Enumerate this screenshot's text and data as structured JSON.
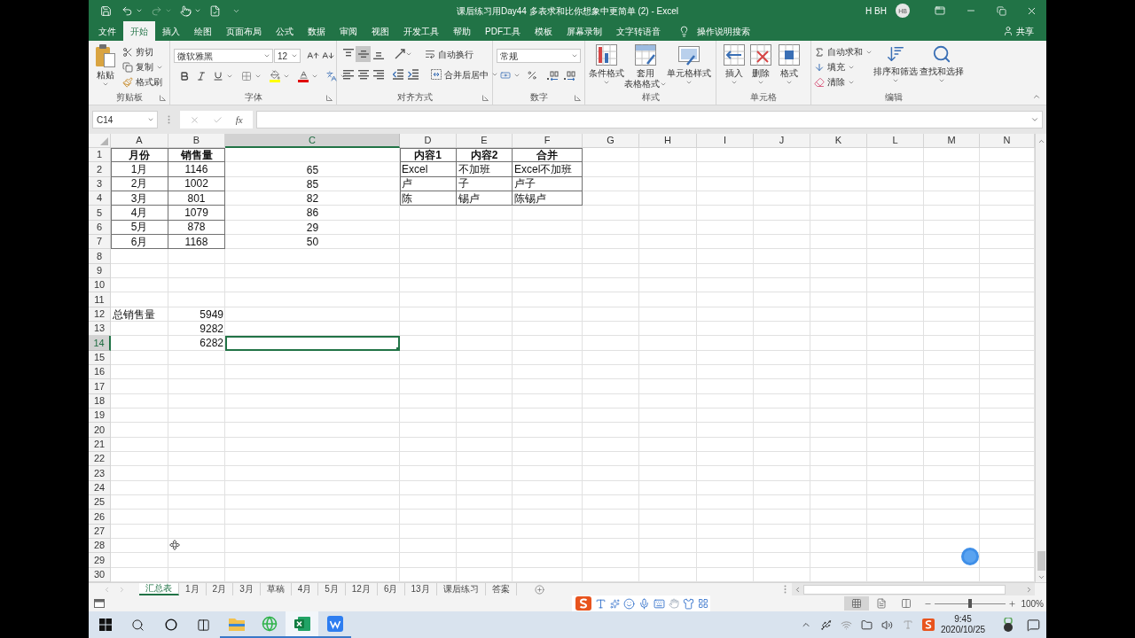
{
  "window": {
    "title": "课后练习用Day44 多表求和比你想象中更简单 (2) - Excel",
    "user": "H BH",
    "avatar": "HB"
  },
  "ribbon_tabs": [
    {
      "label": "文件",
      "selected": false
    },
    {
      "label": "开始",
      "selected": true
    },
    {
      "label": "插入",
      "selected": false
    },
    {
      "label": "绘图",
      "selected": false
    },
    {
      "label": "页面布局",
      "selected": false
    },
    {
      "label": "公式",
      "selected": false
    },
    {
      "label": "数据",
      "selected": false
    },
    {
      "label": "审阅",
      "selected": false
    },
    {
      "label": "视图",
      "selected": false
    },
    {
      "label": "开发工具",
      "selected": false
    },
    {
      "label": "帮助",
      "selected": false
    },
    {
      "label": "PDF工具",
      "selected": false
    },
    {
      "label": "模板",
      "selected": false
    },
    {
      "label": "屏幕录制",
      "selected": false
    },
    {
      "label": "文字转语音",
      "selected": false
    }
  ],
  "tell_me": "操作说明搜索",
  "share": "共享",
  "ribbon": {
    "clipboard": {
      "paste": "粘贴",
      "cut": "剪切",
      "copy": "复制",
      "format_painter": "格式刷",
      "label": "剪贴板"
    },
    "font": {
      "name": "微软雅黑",
      "size": "12",
      "label": "字体"
    },
    "alignment": {
      "vertical": [
        {
          "kind": "top",
          "selected": false
        },
        {
          "kind": "middle",
          "selected": true
        },
        {
          "kind": "bottom",
          "selected": false
        }
      ],
      "wrap_text": "自动换行",
      "merge_center": "合并后居中",
      "label": "对齐方式"
    },
    "number": {
      "format": "常规",
      "label": "数字"
    },
    "styles": {
      "conditional_formatting": "条件格式",
      "format_as_table": [
        "套用",
        "表格格式"
      ],
      "cell_styles": "单元格样式",
      "label": "样式"
    },
    "cells": {
      "insert": "插入",
      "delete": "删除",
      "format": "格式",
      "label": "单元格"
    },
    "editing": {
      "autosum": "自动求和",
      "fill": "填充",
      "clear": "清除",
      "sort_filter": "排序和筛选",
      "find_select": "查找和选择",
      "label": "编辑"
    }
  },
  "formula_bar": {
    "name_box": "C14",
    "function_button": "fx"
  },
  "sheet": {
    "columns": [
      {
        "label": "A",
        "selected": false
      },
      {
        "label": "B",
        "selected": false
      },
      {
        "label": "C",
        "selected": true
      },
      {
        "label": "D",
        "selected": false
      },
      {
        "label": "E",
        "selected": false
      },
      {
        "label": "F",
        "selected": false
      },
      {
        "label": "G",
        "selected": false
      },
      {
        "label": "H",
        "selected": false
      },
      {
        "label": "I",
        "selected": false
      },
      {
        "label": "J",
        "selected": false
      },
      {
        "label": "K",
        "selected": false
      },
      {
        "label": "L",
        "selected": false
      },
      {
        "label": "M",
        "selected": false
      },
      {
        "label": "N",
        "selected": false
      }
    ],
    "rows": [
      {
        "label": "1",
        "selected": false
      },
      {
        "label": "2",
        "selected": false
      },
      {
        "label": "3",
        "selected": false
      },
      {
        "label": "4",
        "selected": false
      },
      {
        "label": "5",
        "selected": false
      },
      {
        "label": "6",
        "selected": false
      },
      {
        "label": "7",
        "selected": false
      },
      {
        "label": "8",
        "selected": false
      },
      {
        "label": "9",
        "selected": false
      },
      {
        "label": "10",
        "selected": false
      },
      {
        "label": "11",
        "selected": false
      },
      {
        "label": "12",
        "selected": false
      },
      {
        "label": "13",
        "selected": false
      },
      {
        "label": "14",
        "selected": true
      },
      {
        "label": "15",
        "selected": false
      },
      {
        "label": "16",
        "selected": false
      },
      {
        "label": "17",
        "selected": false
      },
      {
        "label": "18",
        "selected": false
      },
      {
        "label": "19",
        "selected": false
      },
      {
        "label": "20",
        "selected": false
      },
      {
        "label": "21",
        "selected": false
      },
      {
        "label": "22",
        "selected": false
      },
      {
        "label": "23",
        "selected": false
      },
      {
        "label": "24",
        "selected": false
      },
      {
        "label": "25",
        "selected": false
      },
      {
        "label": "26",
        "selected": false
      },
      {
        "label": "27",
        "selected": false
      },
      {
        "label": "28",
        "selected": false
      },
      {
        "label": "29",
        "selected": false
      },
      {
        "label": "30",
        "selected": false
      }
    ],
    "sales_table": {
      "header": [
        "月份",
        "销售量"
      ],
      "rows": [
        [
          "1月",
          "1146"
        ],
        [
          "2月",
          "1002"
        ],
        [
          "3月",
          "801"
        ],
        [
          "4月",
          "1079"
        ],
        [
          "5月",
          "878"
        ],
        [
          "6月",
          "1168"
        ]
      ]
    },
    "column_c_values": [
      "65",
      "85",
      "82",
      "86",
      "29",
      "50"
    ],
    "content_table": {
      "header": [
        "内容1",
        "内容2",
        "合并"
      ],
      "rows": [
        [
          "Excel",
          "不加班",
          "Excel不加班"
        ],
        [
          "卢",
          "子",
          "卢子"
        ],
        [
          "陈",
          "锡卢",
          "陈锡卢"
        ]
      ]
    },
    "totals": {
      "label": "总销售量",
      "values": [
        "5949",
        "9282",
        "6282"
      ]
    }
  },
  "sheet_tabs": [
    {
      "label": "汇总表",
      "selected": true
    },
    {
      "label": "1月",
      "selected": false
    },
    {
      "label": "2月",
      "selected": false
    },
    {
      "label": "3月",
      "selected": false
    },
    {
      "label": "草稿",
      "selected": false
    },
    {
      "label": "4月",
      "selected": false
    },
    {
      "label": "5月",
      "selected": false
    },
    {
      "label": "12月",
      "selected": false
    },
    {
      "label": "6月",
      "selected": false
    },
    {
      "label": "13月",
      "selected": false
    },
    {
      "label": "课后练习",
      "selected": false
    },
    {
      "label": "答案",
      "selected": false
    }
  ],
  "status_bar": {
    "view_buttons": [
      {
        "kind": "normal",
        "selected": true
      },
      {
        "kind": "page_layout",
        "selected": false
      },
      {
        "kind": "page_break_preview",
        "selected": false
      }
    ],
    "zoom": {
      "level": 0.5,
      "reading": "100%"
    }
  },
  "taskbar": {
    "apps": [
      {
        "kind": "file_explorer",
        "running": true,
        "selected": false
      },
      {
        "kind": "browser",
        "running": true,
        "selected": false
      },
      {
        "kind": "spreadsheet",
        "running": true,
        "selected": true
      },
      {
        "kind": "writer",
        "running": true,
        "selected": false
      }
    ],
    "time": "9:45",
    "date": "2020/10/25"
  }
}
